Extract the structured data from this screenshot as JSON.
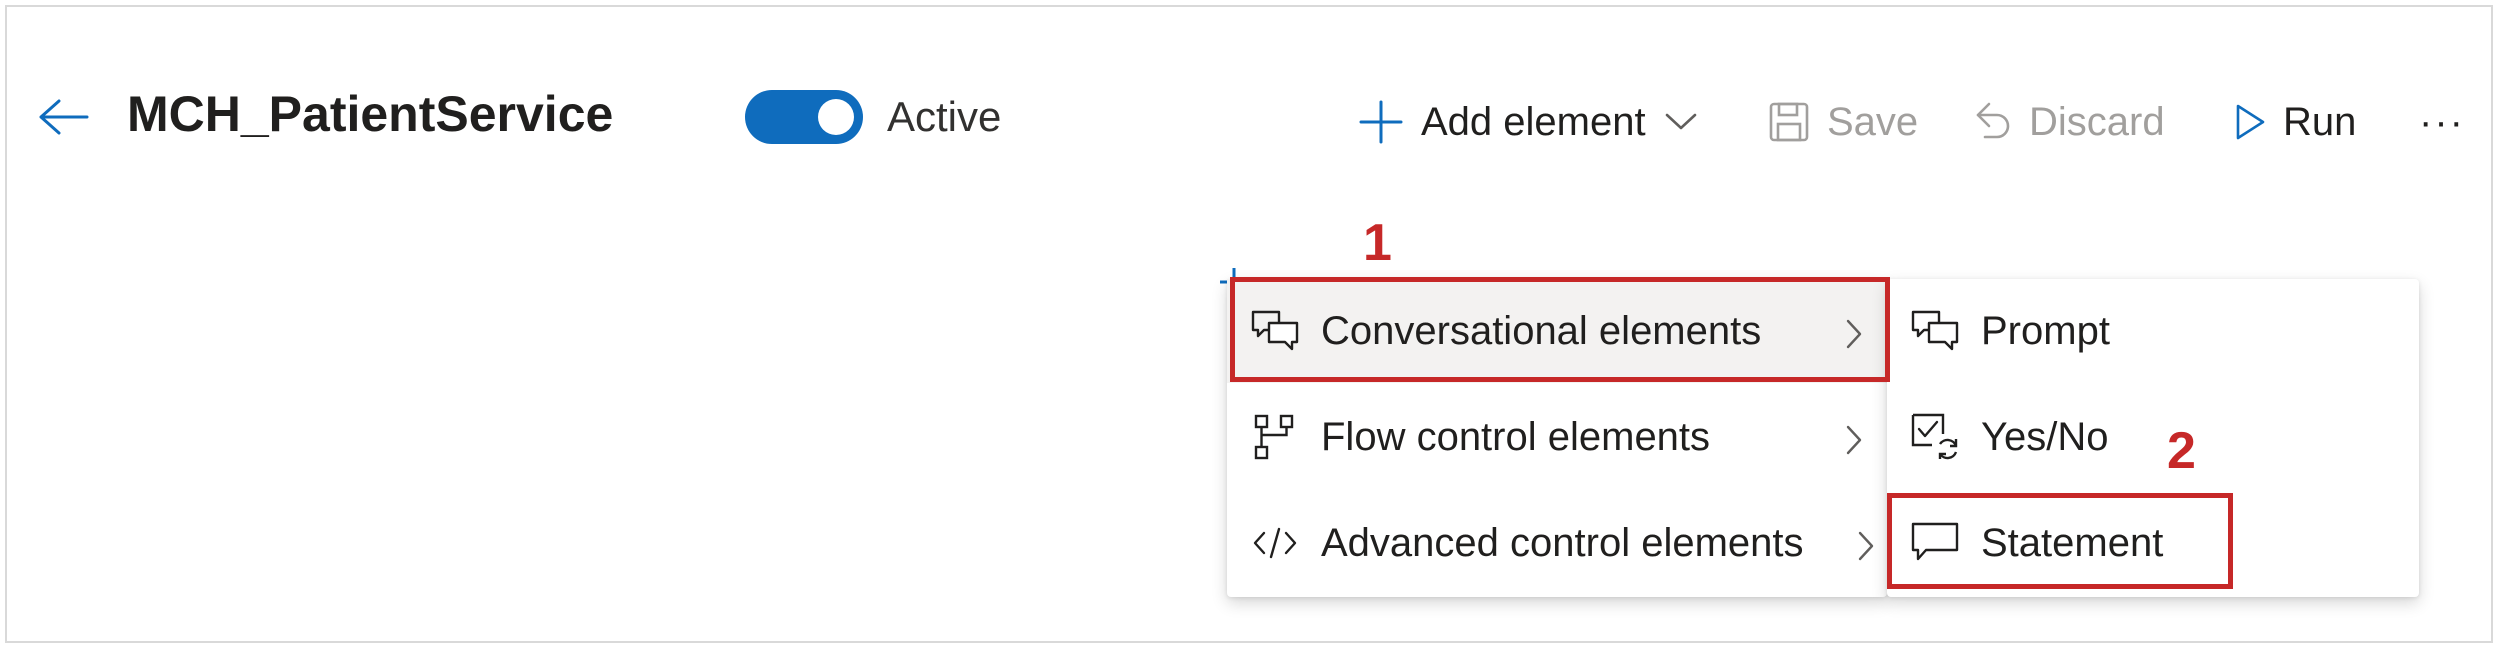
{
  "header": {
    "title": "MCH_PatientService",
    "toggle": {
      "label": "Active",
      "on": true
    },
    "commands": {
      "add_element": "Add element",
      "save": "Save",
      "discard": "Discard",
      "run": "Run",
      "more": "···"
    }
  },
  "menu": {
    "items": [
      {
        "label": "Conversational elements",
        "icon": "conversation-icon",
        "highlighted": true
      },
      {
        "label": "Flow control elements",
        "icon": "flow-icon"
      },
      {
        "label": "Advanced control elements",
        "icon": "code-icon"
      }
    ]
  },
  "submenu": {
    "items": [
      {
        "label": "Prompt",
        "icon": "conversation-icon"
      },
      {
        "label": "Yes/No",
        "icon": "checkbox-sync-icon"
      },
      {
        "label": "Statement",
        "icon": "comment-icon",
        "highlighted": true
      }
    ]
  },
  "annotations": {
    "step1": "1",
    "step2": "2"
  },
  "colors": {
    "accent": "#0f6cbd",
    "callout": "#c62828",
    "disabled": "#a19f9d"
  }
}
